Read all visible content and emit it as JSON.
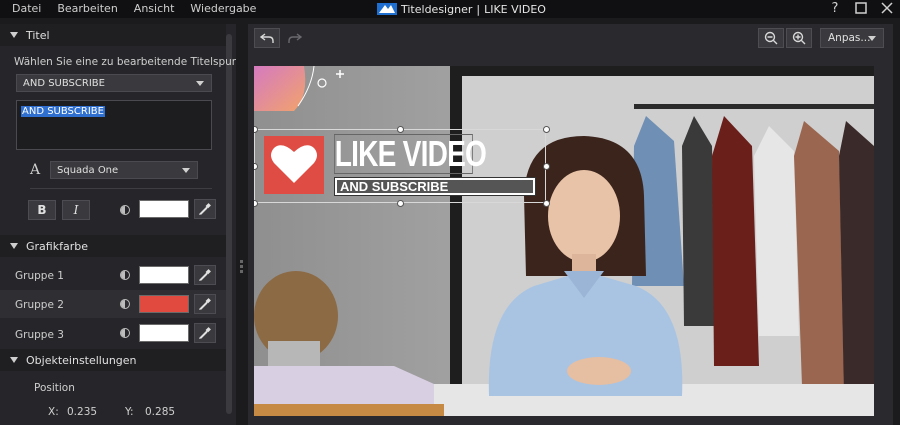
{
  "menu": [
    "Datei",
    "Bearbeiten",
    "Ansicht",
    "Wiedergabe"
  ],
  "window": {
    "app_name": "Titeldesigner",
    "separator": "|",
    "doc_name": "LIKE VIDEO",
    "help": "?"
  },
  "sections": {
    "titel": "Titel",
    "grafikfarbe": "Grafikfarbe",
    "objekt": "Objekteinstellungen"
  },
  "titel": {
    "prompt": "Wählen Sie eine zu bearbeitende Titelspur aus:",
    "track_selected": "AND SUBSCRIBE",
    "text_value": "AND SUBSCRIBE",
    "font_glyph": "A",
    "font_name": "Squada One",
    "bold_label": "B",
    "italic_label": "I",
    "text_color": "#ffffff"
  },
  "groups": [
    {
      "label": "Gruppe 1",
      "color": "#ffffff"
    },
    {
      "label": "Gruppe 2",
      "color": "#e04a3f"
    },
    {
      "label": "Gruppe 3",
      "color": "#ffffff"
    }
  ],
  "position": {
    "label": "Position",
    "x_label": "X:",
    "x_value": "0.235",
    "y_label": "Y:",
    "y_value": "0.285"
  },
  "preview": {
    "zoom": "Anpas...",
    "title_main": "LIKE VIDEO",
    "title_sub": "AND SUBSCRIBE",
    "heart_color": "#de4c43",
    "accent_color": "#2f6fd0"
  }
}
